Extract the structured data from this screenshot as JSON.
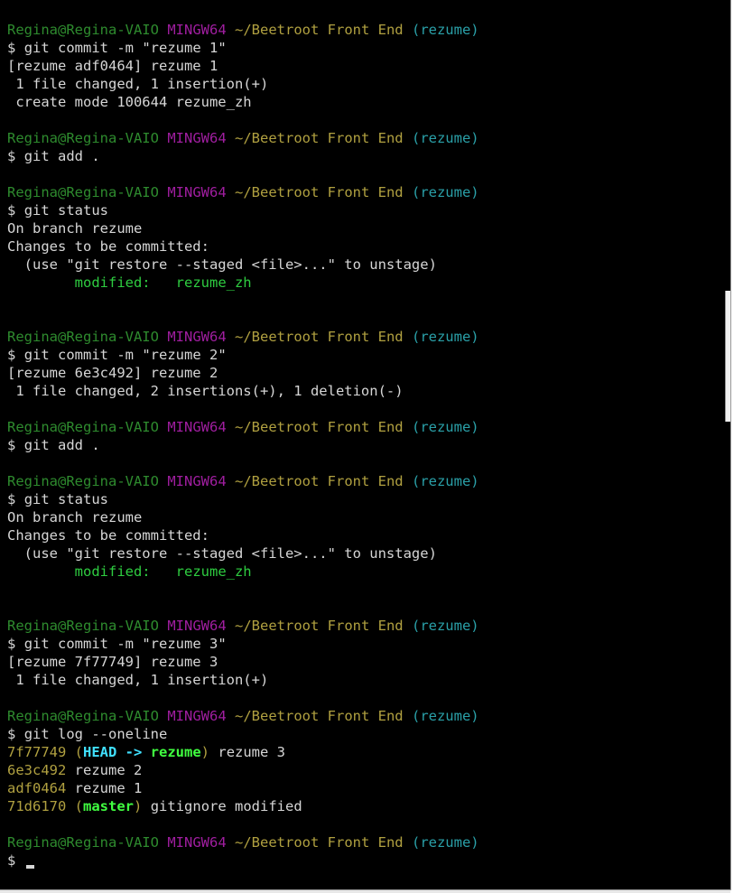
{
  "prompt": {
    "user": "Regina@Regina-VAIO",
    "system": "MINGW64",
    "path": "~/Beetroot Front End",
    "branch": "(rezume)",
    "symbol": "$"
  },
  "lines": [
    {
      "type": "prompt"
    },
    {
      "type": "cmd",
      "text": "git commit -m \"rezume 1\""
    },
    {
      "type": "out",
      "text": "[rezume adf0464] rezume 1"
    },
    {
      "type": "out",
      "text": " 1 file changed, 1 insertion(+)"
    },
    {
      "type": "out",
      "text": " create mode 100644 rezume_zh"
    },
    {
      "type": "blank"
    },
    {
      "type": "prompt"
    },
    {
      "type": "cmd",
      "text": "git add ."
    },
    {
      "type": "blank"
    },
    {
      "type": "prompt"
    },
    {
      "type": "cmd",
      "text": "git status"
    },
    {
      "type": "out",
      "text": "On branch rezume"
    },
    {
      "type": "out",
      "text": "Changes to be committed:"
    },
    {
      "type": "out",
      "text": "  (use \"git restore --staged <file>...\" to unstage)"
    },
    {
      "type": "mod",
      "label": "modified:",
      "file": "rezume_zh"
    },
    {
      "type": "blank"
    },
    {
      "type": "blank"
    },
    {
      "type": "prompt"
    },
    {
      "type": "cmd",
      "text": "git commit -m \"rezume 2\""
    },
    {
      "type": "out",
      "text": "[rezume 6e3c492] rezume 2"
    },
    {
      "type": "out",
      "text": " 1 file changed, 2 insertions(+), 1 deletion(-)"
    },
    {
      "type": "blank"
    },
    {
      "type": "prompt"
    },
    {
      "type": "cmd",
      "text": "git add ."
    },
    {
      "type": "blank"
    },
    {
      "type": "prompt"
    },
    {
      "type": "cmd",
      "text": "git status"
    },
    {
      "type": "out",
      "text": "On branch rezume"
    },
    {
      "type": "out",
      "text": "Changes to be committed:"
    },
    {
      "type": "out",
      "text": "  (use \"git restore --staged <file>...\" to unstage)"
    },
    {
      "type": "mod",
      "label": "modified:",
      "file": "rezume_zh"
    },
    {
      "type": "blank"
    },
    {
      "type": "blank"
    },
    {
      "type": "prompt"
    },
    {
      "type": "cmd",
      "text": "git commit -m \"rezume 3\""
    },
    {
      "type": "out",
      "text": "[rezume 7f77749] rezume 3"
    },
    {
      "type": "out",
      "text": " 1 file changed, 1 insertion(+)"
    },
    {
      "type": "blank"
    },
    {
      "type": "prompt"
    },
    {
      "type": "cmd",
      "text": "git log --oneline"
    },
    {
      "type": "log",
      "hash": "7f77749",
      "refs": "HEAD -> rezume",
      "head": "HEAD",
      "arrow": " -> ",
      "ref": "rezume",
      "msg": "rezume 3"
    },
    {
      "type": "log",
      "hash": "6e3c492",
      "msg": "rezume 2"
    },
    {
      "type": "log",
      "hash": "adf0464",
      "msg": "rezume 1"
    },
    {
      "type": "log",
      "hash": "71d6170",
      "ref": "master",
      "msg": "gitignore modified"
    },
    {
      "type": "blank"
    },
    {
      "type": "prompt"
    },
    {
      "type": "input",
      "text": ""
    }
  ]
}
